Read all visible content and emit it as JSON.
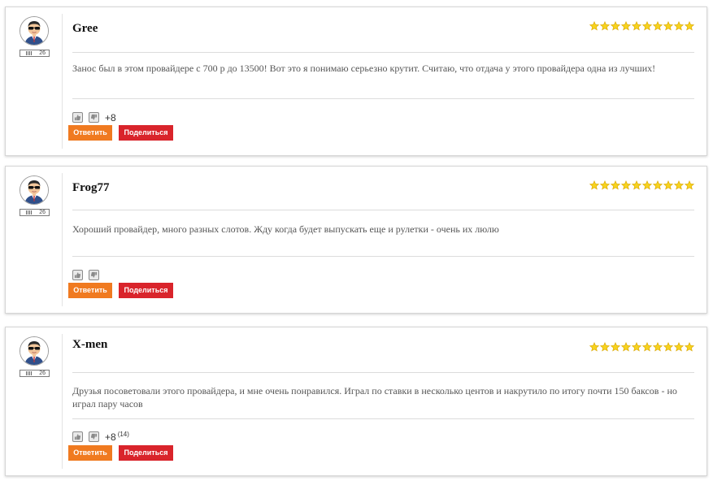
{
  "colors": {
    "reply": "#f07a20",
    "share": "#d9242b",
    "star": "#f7d31e"
  },
  "comments": [
    {
      "author": "Gree",
      "level": "26",
      "rating": 10,
      "text": "Занос был в этом провайдере с 700 р до 13500! Вот это я понимаю серьезно крутит. Считаю, что отдача у этого провайдера одна из лучших!",
      "score": "+8",
      "score_extra": "",
      "reply_label": "Ответить",
      "share_label": "Поделиться"
    },
    {
      "author": "Frog77",
      "level": "26",
      "rating": 10,
      "text": "Хороший провайдер, много разных слотов. Жду когда будет выпускать еще и рулетки - очень их люлю",
      "score": "",
      "score_extra": "",
      "reply_label": "Ответить",
      "share_label": "Поделиться"
    },
    {
      "author": "X-men",
      "level": "26",
      "rating": 10,
      "text": "Друзья посоветовали этого провайдера, и мне очень понравился. Играл по ставки в несколько центов и накрутило по итогу почти 150 баксов - но играл пару часов",
      "score": "+8",
      "score_extra": "(14)",
      "reply_label": "Ответить",
      "share_label": "Поделиться"
    }
  ]
}
